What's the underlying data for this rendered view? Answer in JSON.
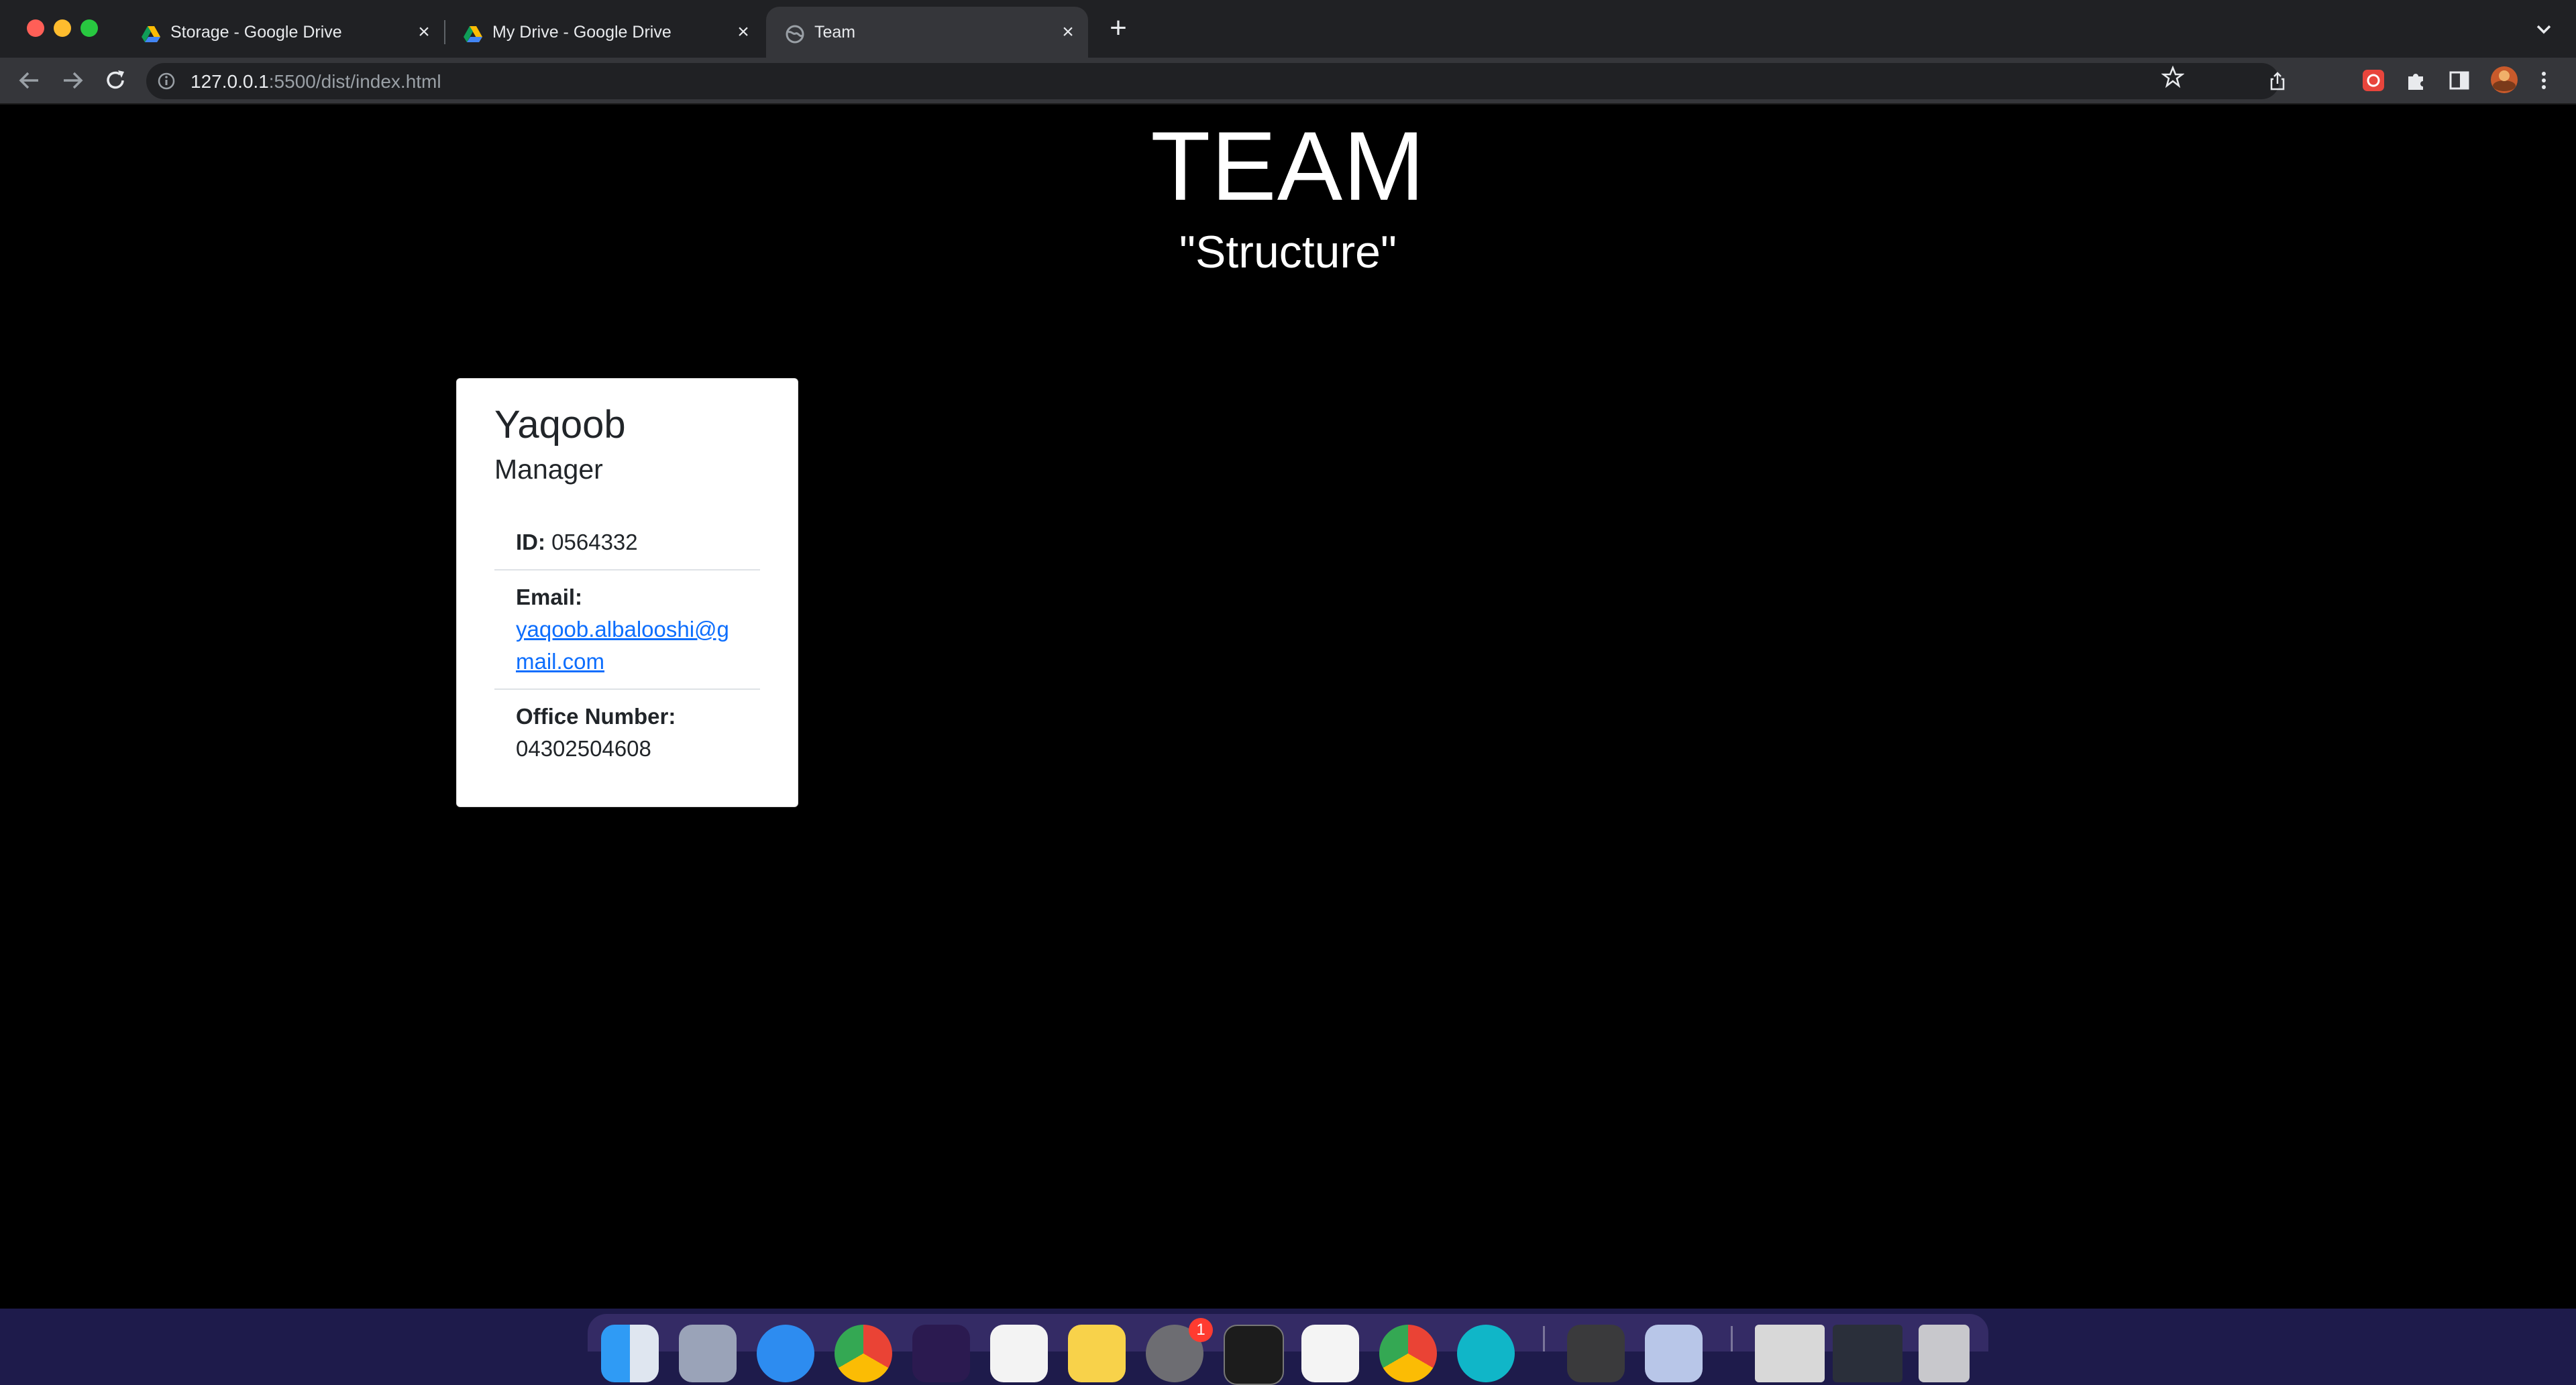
{
  "browser": {
    "tabs": [
      {
        "title": "Storage - Google Drive",
        "icon": "google-drive-icon",
        "active": false
      },
      {
        "title": "My Drive - Google Drive",
        "icon": "google-drive-icon",
        "active": false
      },
      {
        "title": "Team",
        "icon": "globe-icon",
        "active": true
      }
    ],
    "address": {
      "host": "127.0.0.1",
      "rest": ":5500/dist/index.html"
    }
  },
  "page": {
    "title": "TEAM",
    "subtitle": "\"Structure\""
  },
  "employee": {
    "name": "Yaqoob",
    "role": "Manager",
    "id_label": "ID:",
    "id_value": "0564332",
    "email_label": "Email:",
    "email_value": "yaqoob.albalooshi@gmail.com",
    "office_label": "Office Number:",
    "office_value": "04302504608"
  },
  "dock": {
    "badge_count": "1",
    "apps": [
      "finder-icon",
      "launchpad-icon",
      "safari-icon",
      "chrome-icon",
      "firefox-icon",
      "vscode-icon",
      "notes-icon",
      "system-preferences-icon",
      "terminal-icon",
      "slack-icon",
      "chrome-dev-icon",
      "app-icon",
      "screen-icon",
      "preview-icon",
      "window-thumbnail-icon",
      "window-thumbnail-icon",
      "trash-icon"
    ]
  },
  "colors": {
    "link": "#0d6efd",
    "page_bg": "#000000",
    "tab_bar": "#202124",
    "toolbar": "#35363a"
  }
}
